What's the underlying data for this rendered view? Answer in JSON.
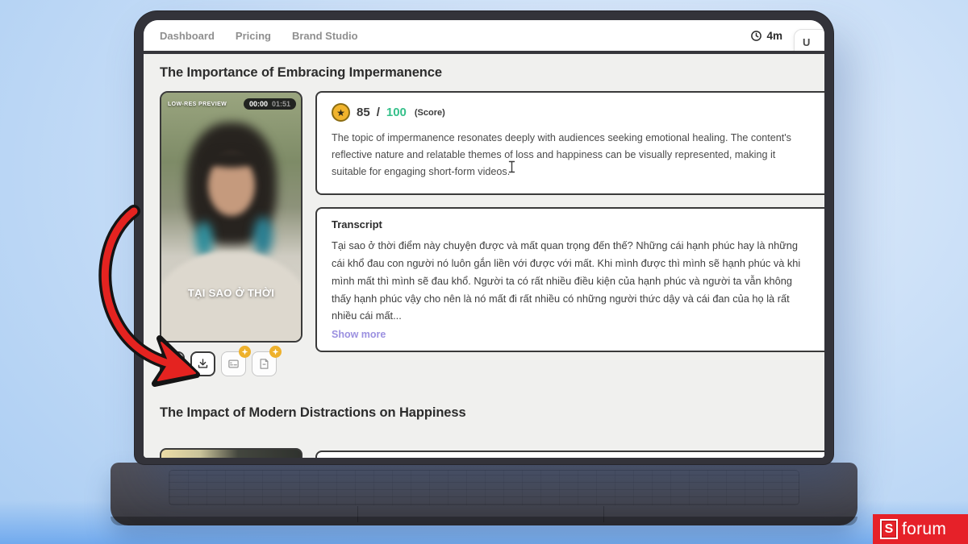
{
  "nav": {
    "items": [
      "Dashboard",
      "Pricing",
      "Brand Studio"
    ],
    "timer": "4m",
    "partial_button": "U"
  },
  "content": {
    "video_title": "The Importance of Embracing Impermanence",
    "video": {
      "preview_badge": "LOW-RES PREVIEW",
      "current_time": "00:00",
      "duration": "01:51",
      "caption": "TẠI SAO Ở THỜI"
    },
    "score": {
      "value": "85",
      "divider": "/",
      "max": "100",
      "suffix": "(Score)",
      "description": "The topic of impermanence resonates deeply with audiences seeking emotional healing. The content's reflective nature and relatable themes of loss and happiness can be visually represented, making it suitable for engaging short-form videos."
    },
    "transcript": {
      "title": "Transcript",
      "body": "Tại sao ở thời điểm này chuyện được và mất quan trọng đến thế? Những cái hạnh phúc hay là những cái khổ đau con người nó luôn gắn liền với được với mất. Khi mình được thì mình sẽ hạnh phúc và khi mình mất thì mình sẽ đau khổ. Người ta có rất nhiều điều kiện của hạnh phúc và người ta vẫn không thấy hạnh phúc vậy cho nên là nó mất đi rất nhiều có những người thức dậy và cái đan của họ là rất nhiều cái mất...",
      "show_more": "Show more"
    },
    "next_title": "The Impact of Modern Distractions on Happiness"
  },
  "icons": {
    "clock": "clock-icon",
    "edit": "pencil-icon",
    "download": "download-icon",
    "captions": "caption-card-icon",
    "script": "document-icon",
    "premium_badge": "sparkle-badge-icon",
    "score": "star-icon"
  },
  "watermark": {
    "letter": "S",
    "text": "forum"
  },
  "colors": {
    "score_green": "#35c08a",
    "badge_gold": "#eeb12c",
    "show_more_purple": "#9b90e0",
    "arrow_red": "#e42320",
    "logo_red": "#e62129",
    "card_border": "#3a3a3a"
  }
}
